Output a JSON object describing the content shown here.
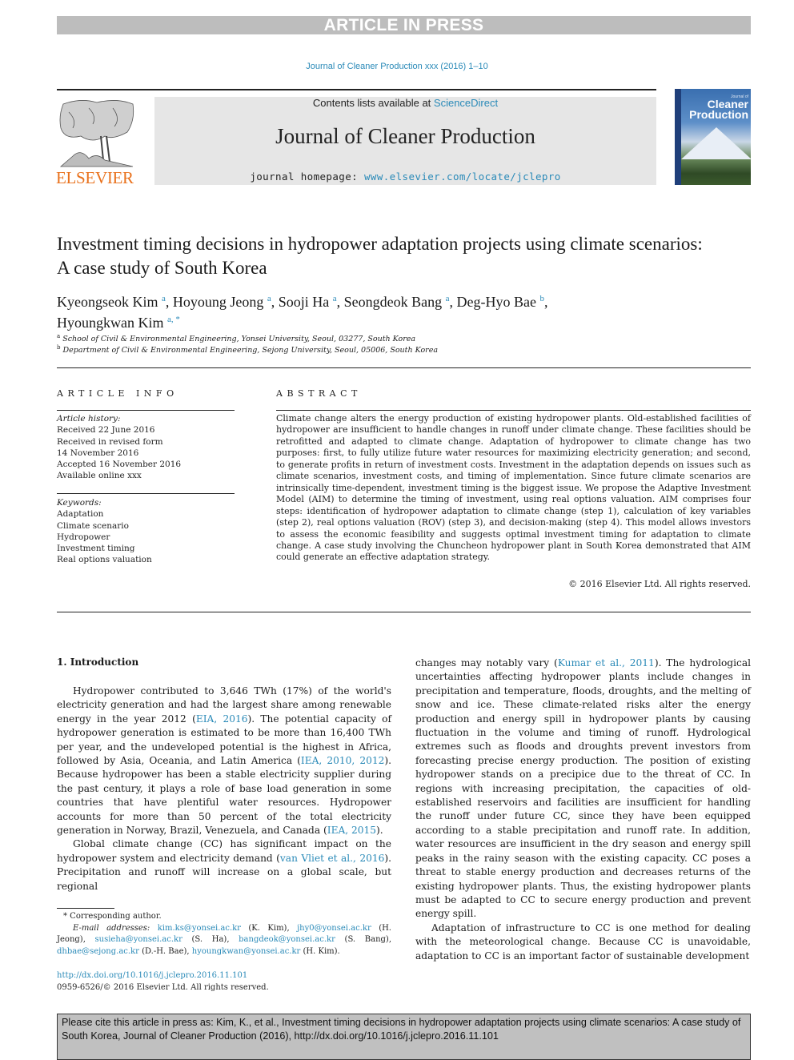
{
  "banner": "ARTICLE IN PRESS",
  "journal_ref": "Journal of Cleaner Production xxx (2016) 1–10",
  "masthead": {
    "contents_prefix": "Contents lists available at ",
    "contents_link": "ScienceDirect",
    "journal_name": "Journal of Cleaner Production",
    "homepage_prefix": "journal homepage: ",
    "homepage_link": "www.elsevier.com/locate/jclepro",
    "publisher": "ELSEVIER",
    "cover": {
      "small_title": "Journal of",
      "title_line1": "Cleaner",
      "title_line2": "Production"
    }
  },
  "article": {
    "title": "Investment timing decisions in hydropower adaptation projects using climate scenarios: A case study of South Korea",
    "authors": [
      {
        "name": "Kyeongseok Kim",
        "aff": "a",
        "sep": ", "
      },
      {
        "name": "Hoyoung Jeong",
        "aff": "a",
        "sep": ", "
      },
      {
        "name": "Sooji Ha",
        "aff": "a",
        "sep": ", "
      },
      {
        "name": "Seongdeok Bang",
        "aff": "a",
        "sep": ", "
      },
      {
        "name": "Deg-Hyo Bae",
        "aff": "b",
        "sep": ","
      },
      {
        "name": "Hyoungkwan Kim",
        "aff": "a, *",
        "sep": ""
      }
    ],
    "affiliations": [
      {
        "key": "a",
        "text": "School of Civil & Environmental Engineering, Yonsei University, Seoul, 03277, South Korea"
      },
      {
        "key": "b",
        "text": "Department of Civil & Environmental Engineering, Sejong University, Seoul, 05006, South Korea"
      }
    ]
  },
  "article_info": {
    "heading": "ARTICLE INFO",
    "history_label": "Article history:",
    "history": [
      "Received 22 June 2016",
      "Received in revised form",
      "14 November 2016",
      "Accepted 16 November 2016",
      "Available online xxx"
    ],
    "keywords_label": "Keywords:",
    "keywords": [
      "Adaptation",
      "Climate scenario",
      "Hydropower",
      "Investment timing",
      "Real options valuation"
    ]
  },
  "abstract": {
    "heading": "ABSTRACT",
    "text": "Climate change alters the energy production of existing hydropower plants. Old-established facilities of hydropower are insufficient to handle changes in runoff under climate change. These facilities should be retrofitted and adapted to climate change. Adaptation of hydropower to climate change has two purposes: first, to fully utilize future water resources for maximizing electricity generation; and second, to generate profits in return of investment costs. Investment in the adaptation depends on issues such as climate scenarios, investment costs, and timing of implementation. Since future climate scenarios are intrinsically time-dependent, investment timing is the biggest issue. We propose the Adaptive Investment Model (AIM) to determine the timing of investment, using real options valuation. AIM comprises four steps: identification of hydropower adaptation to climate change (step 1), calculation of key variables (step 2), real options valuation (ROV) (step 3), and decision-making (step 4). This model allows investors to assess the economic feasibility and suggests optimal investment timing for adaptation to climate change. A case study involving the Chuncheon hydropower plant in South Korea demonstrated that AIM could generate an effective adaptation strategy.",
    "copyright": "© 2016 Elsevier Ltd. All rights reserved."
  },
  "intro": {
    "heading": "1.  Introduction",
    "left": {
      "p1": [
        {
          "t": "Hydropower contributed to 3,646 TWh (17%) of the world's electricity generation and had the largest share among renewable energy in the year 2012 ("
        },
        {
          "link": "EIA, 2016"
        },
        {
          "t": "). The potential capacity of hydropower generation is estimated to be more than 16,400 TWh per year, and the undeveloped potential is the highest in Africa, followed by Asia, Oceania, and Latin America ("
        },
        {
          "link": "IEA, 2010, 2012"
        },
        {
          "t": "). Because hydropower has been a stable electricity supplier during the past century, it plays a role of base load generation in some countries that have plentiful water resources. Hydropower accounts for more than 50 percent of the total electricity generation in Norway, Brazil, Venezuela, and Canada ("
        },
        {
          "link": "IEA, 2015"
        },
        {
          "t": ")."
        }
      ],
      "p2": [
        {
          "t": "Global climate change (CC) has significant impact on the hydropower system and electricity demand ("
        },
        {
          "link": "van Vliet et al., 2016"
        },
        {
          "t": "). Precipitation and runoff will increase on a global scale, but regional"
        }
      ]
    },
    "right": {
      "p1": [
        {
          "t": "changes may notably vary ("
        },
        {
          "link": "Kumar et al., 2011"
        },
        {
          "t": "). The hydrological uncertainties affecting hydropower plants include changes in precipitation and temperature, floods, droughts, and the melting of snow and ice. These climate-related risks alter the energy production and energy spill in hydropower plants by causing fluctuation in the volume and timing of runoff. Hydrological extremes such as floods and droughts prevent investors from forecasting precise energy production. The position of existing hydropower stands on a precipice due to the threat of CC. In regions with increasing precipitation, the capacities of old-established reservoirs and facilities are insufficient for handling the runoff under future CC, since they have been equipped according to a stable precipitation and runoff rate. In addition, water resources are insufficient in the dry season and energy spill peaks in the rainy season with the existing capacity. CC poses a threat to stable energy production and decreases returns of the existing hydropower plants. Thus, the existing hydropower plants must be adapted to CC to secure energy production and prevent energy spill."
        }
      ],
      "p2": [
        {
          "t": "Adaptation of infrastructure to CC is one method for dealing with the meteorological change. Because CC is unavoidable, adaptation to CC is an important factor of sustainable development"
        }
      ]
    }
  },
  "footnotes": {
    "corresponding": "* Corresponding author.",
    "emails_label": "E-mail addresses: ",
    "emails": [
      {
        "email": "kim.ks@yonsei.ac.kr",
        "who": " (K. Kim), "
      },
      {
        "email": "jhy0@yonsei.ac.kr",
        "who": " (H. Jeong), "
      },
      {
        "email": "susieha@yonsei.ac.kr",
        "who": " (S. Ha), "
      },
      {
        "email": "bangdeok@yonsei.ac.kr",
        "who": " (S. Bang), "
      },
      {
        "email": "dhbae@sejong.ac.kr",
        "who": " (D.-H. Bae), "
      },
      {
        "email": "hyoungkwan@yonsei.ac.kr",
        "who": " (H. Kim)."
      }
    ],
    "doi_link": "http://dx.doi.org/10.1016/j.jclepro.2016.11.101",
    "issn_line": "0959-6526/© 2016 Elsevier Ltd. All rights reserved."
  },
  "cite_box": "Please cite this article in press as: Kim, K., et al., Investment timing decisions in hydropower adaptation projects using climate scenarios: A case study of South Korea, Journal of Cleaner Production (2016), http://dx.doi.org/10.1016/j.jclepro.2016.11.101",
  "colors": {
    "link": "#2a8ab8",
    "elsevier_orange": "#e9711c",
    "banner_gray": "#bdbdbd",
    "masthead_gray": "#e6e6e6"
  }
}
